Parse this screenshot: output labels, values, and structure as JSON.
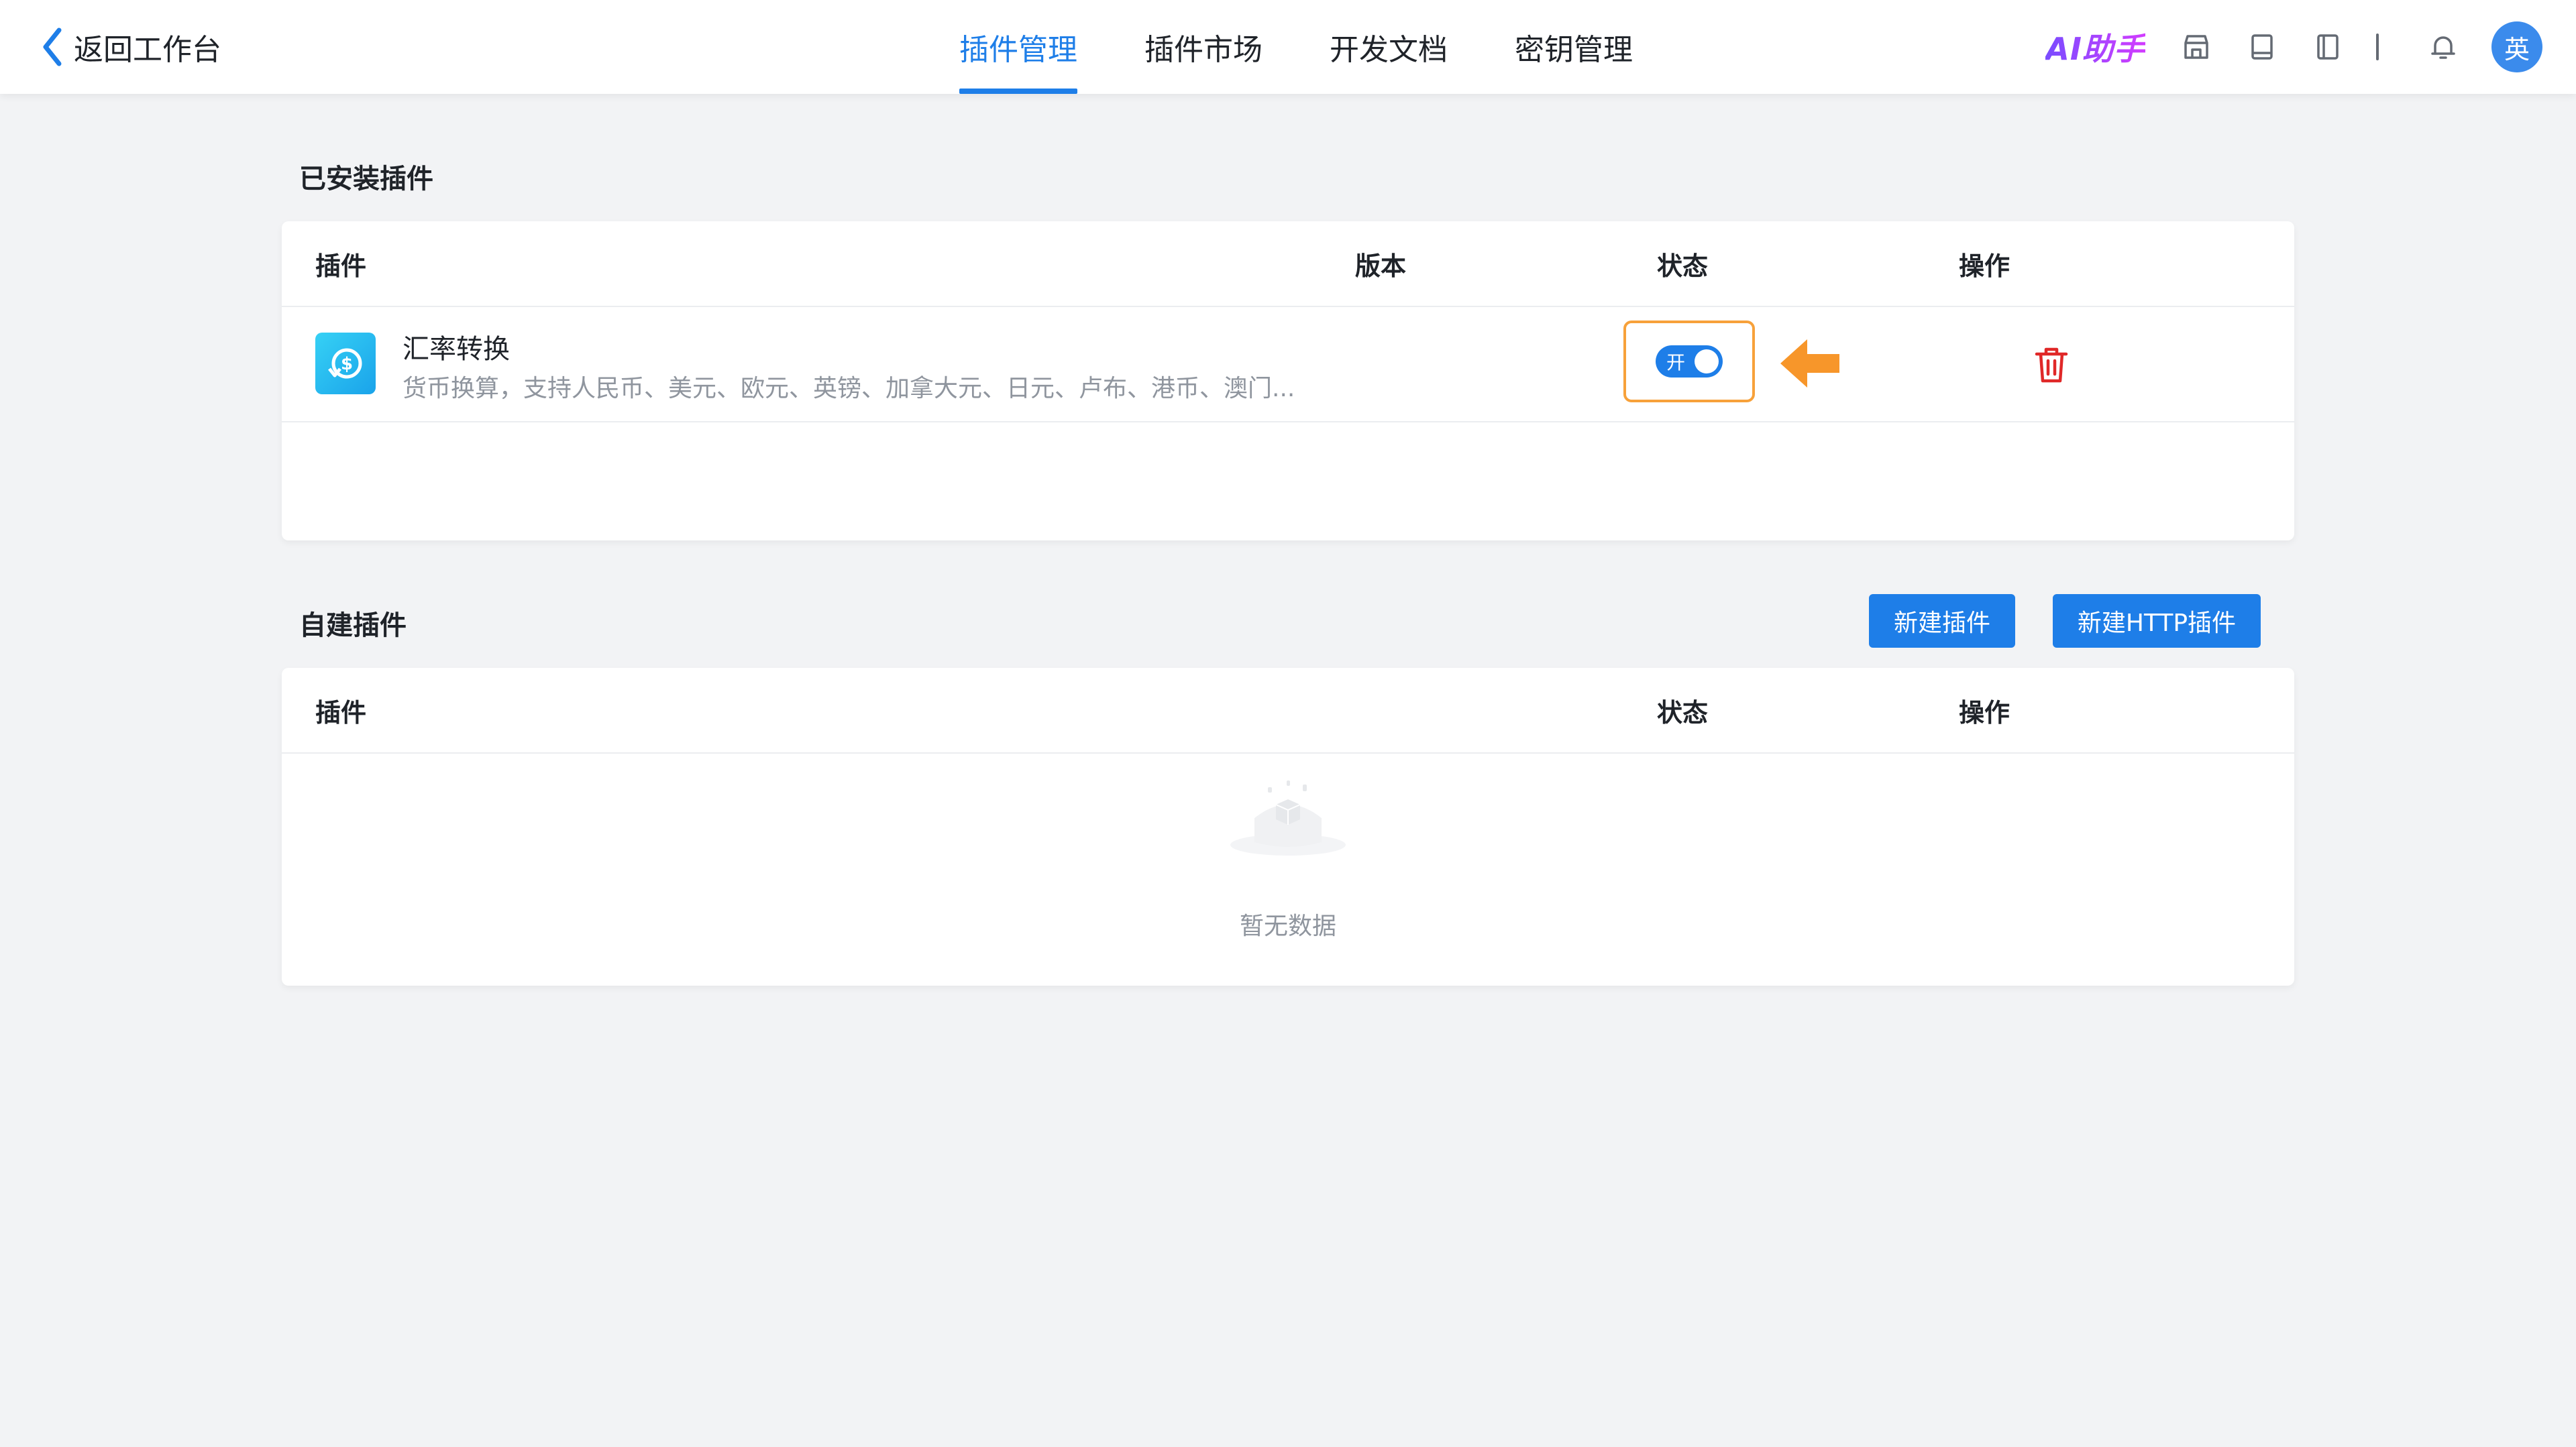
{
  "header": {
    "back_label": "返回工作台",
    "tabs": [
      {
        "label": "插件管理",
        "active": true
      },
      {
        "label": "插件市场",
        "active": false
      },
      {
        "label": "开发文档",
        "active": false
      },
      {
        "label": "密钥管理",
        "active": false
      }
    ],
    "ai_label": "AI助手",
    "avatar_text": "英",
    "accent_color": "#1e7ee8"
  },
  "installed": {
    "title": "已安装插件",
    "columns": {
      "plugin": "插件",
      "version": "版本",
      "status": "状态",
      "action": "操作"
    },
    "rows": [
      {
        "name": "汇率转换",
        "description": "货币换算，支持人民币、美元、欧元、英镑、加拿大元、日元、卢布、港币、澳门...",
        "version": "",
        "switch_label": "开",
        "enabled": true
      }
    ]
  },
  "custom": {
    "title": "自建插件",
    "buttons": {
      "new_plugin": "新建插件",
      "new_http_plugin": "新建HTTP插件"
    },
    "columns": {
      "plugin": "插件",
      "status": "状态",
      "action": "操作"
    },
    "empty_text": "暂无数据"
  }
}
